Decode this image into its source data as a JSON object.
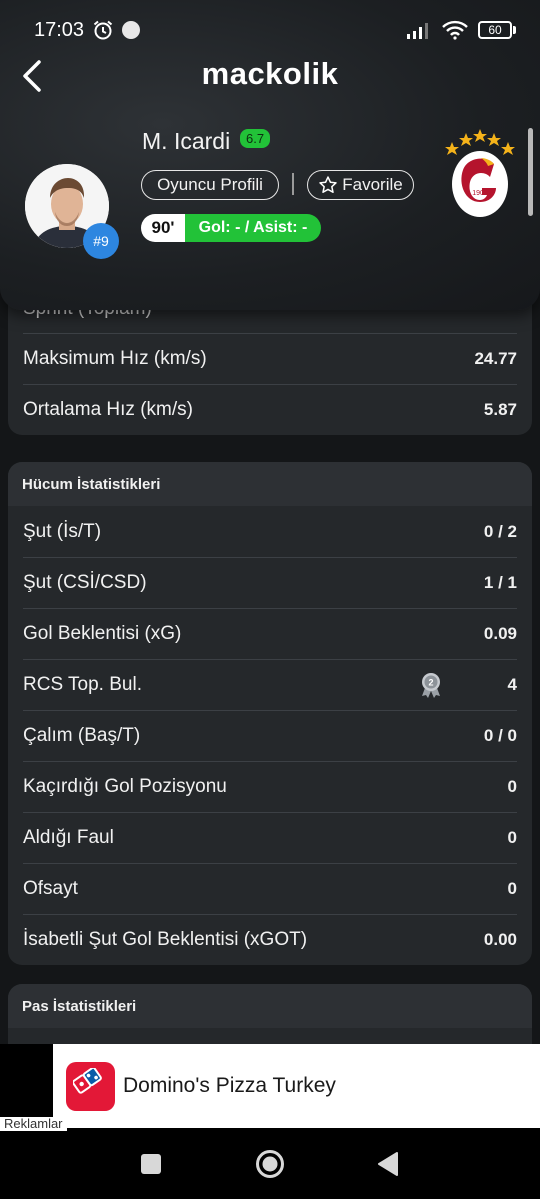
{
  "status_bar": {
    "time": "17:03",
    "battery": "60"
  },
  "header": {
    "brand": "mackolik",
    "player_name": "M. Icardi",
    "rating": "6.7",
    "jersey": "#9",
    "profile_label": "Oyuncu Profili",
    "favorite_label": "Favorile",
    "minute": "90'",
    "goal_assist": "Gol: - / Asist: -",
    "club_year": "1905"
  },
  "speed_section": {
    "partial_label": "Sprint (Toplam)",
    "rows": [
      {
        "label": "Maksimum Hız (km/s)",
        "value": "24.77"
      },
      {
        "label": "Ortalama Hız (km/s)",
        "value": "5.87"
      }
    ]
  },
  "attack_section": {
    "title": "Hücum İstatistikleri",
    "rows": [
      {
        "label": "Şut (İs/T)",
        "value": "0 / 2"
      },
      {
        "label": "Şut (CSİ/CSD)",
        "value": "1 / 1"
      },
      {
        "label": "Gol Beklentisi (xG)",
        "value": "0.09"
      },
      {
        "label": "RCS Top. Bul.",
        "value": "4",
        "rank": "2"
      },
      {
        "label": "Çalım (Baş/T)",
        "value": "0 / 0"
      },
      {
        "label": "Kaçırdığı Gol Pozisyonu",
        "value": "0"
      },
      {
        "label": "Aldığı Faul",
        "value": "0"
      },
      {
        "label": "Ofsayt",
        "value": "0"
      },
      {
        "label": "İsabetli Şut Gol Beklentisi (xGOT)",
        "value": "0.00"
      }
    ]
  },
  "pass_section": {
    "title": "Pas İstatistikleri"
  },
  "ad": {
    "title": "Domino's Pizza Turkey",
    "label": "Reklamlar"
  },
  "colors": {
    "accent_green": "#22c238",
    "badge_blue": "#2d86e0",
    "card_bg": "#25282b",
    "dominos_red": "#e31837"
  }
}
